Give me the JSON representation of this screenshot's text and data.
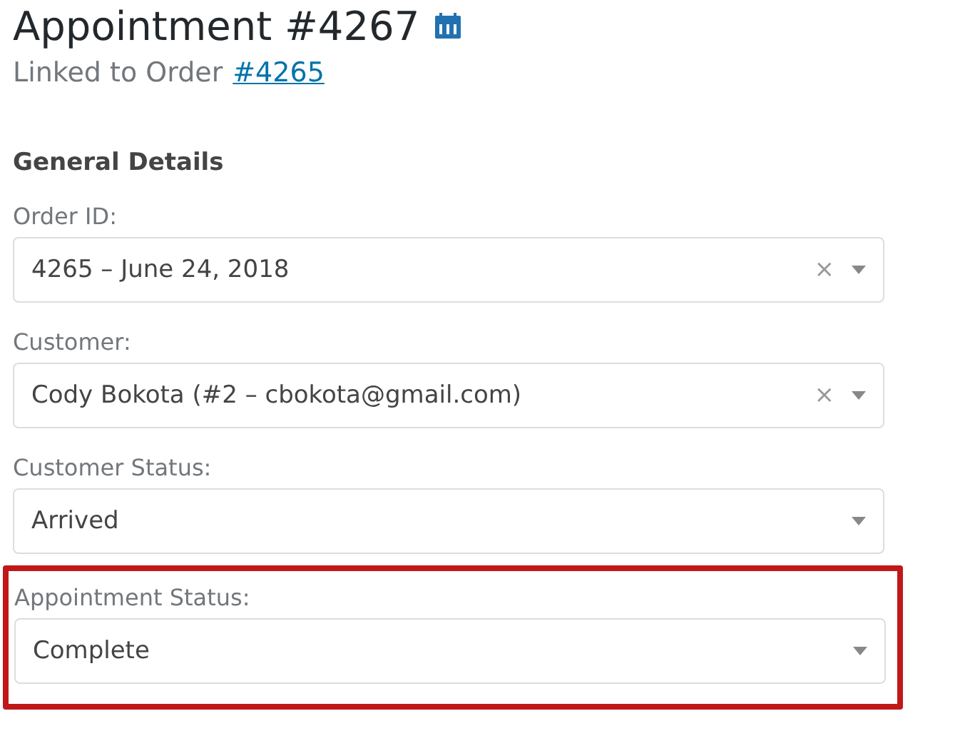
{
  "title": "Appointment #4267",
  "subtitle": {
    "text": "Linked to Order",
    "link": "#4265"
  },
  "section_title": "General Details",
  "fields": [
    {
      "label": "Order ID:",
      "value": "4265 – June 24, 2018",
      "clear": "×",
      "highlighted": false
    },
    {
      "label": "Customer:",
      "value": "Cody Bokota (#2 – cbokota@gmail.com)",
      "clear": "×",
      "highlighted": false
    },
    {
      "label": "Customer Status:",
      "value": "Arrived",
      "highlighted": false
    },
    {
      "label": "Appointment Status:",
      "value": "Complete",
      "highlighted": true
    }
  ]
}
